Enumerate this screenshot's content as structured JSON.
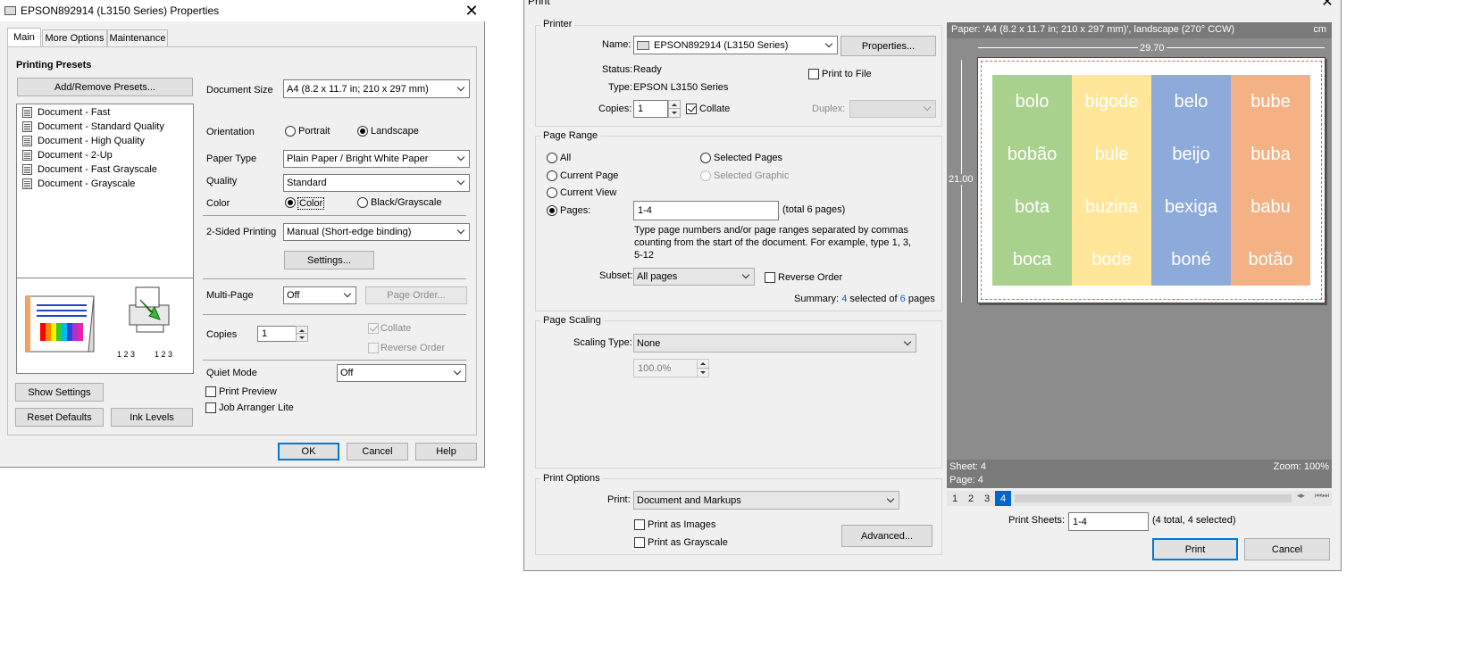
{
  "props": {
    "title": "EPSON892914 (L3150 Series) Properties",
    "tabs": [
      "Main",
      "More Options",
      "Maintenance"
    ],
    "presets_heading": "Printing Presets",
    "add_remove_presets": "Add/Remove Presets...",
    "presets": [
      "Document - Fast",
      "Document - Standard Quality",
      "Document - High Quality",
      "Document - 2-Up",
      "Document - Fast Grayscale",
      "Document - Grayscale"
    ],
    "show_settings": "Show Settings",
    "reset_defaults": "Reset Defaults",
    "ink_levels": "Ink Levels",
    "document_size_label": "Document Size",
    "document_size_value": "A4 (8.2 x 11.7 in; 210 x 297 mm)",
    "orientation_label": "Orientation",
    "portrait": "Portrait",
    "landscape": "Landscape",
    "paper_type_label": "Paper Type",
    "paper_type_value": "Plain Paper / Bright White Paper",
    "quality_label": "Quality",
    "quality_value": "Standard",
    "color_label": "Color",
    "color_option": "Color",
    "black_grayscale": "Black/Grayscale",
    "two_sided_label": "2-Sided Printing",
    "two_sided_value": "Manual (Short-edge binding)",
    "settings_button": "Settings...",
    "multi_page_label": "Multi-Page",
    "multi_page_value": "Off",
    "page_order_button": "Page Order...",
    "copies_label": "Copies",
    "copies_value": "1",
    "collate": "Collate",
    "reverse_order": "Reverse Order",
    "quiet_mode_label": "Quiet Mode",
    "quiet_mode_value": "Off",
    "print_preview": "Print Preview",
    "job_arranger": "Job Arranger Lite",
    "ok": "OK",
    "cancel": "Cancel",
    "help": "Help"
  },
  "print": {
    "title": "Print",
    "printer_group": "Printer",
    "name_label": "Name:",
    "name_value": "EPSON892914 (L3150 Series)",
    "properties_button": "Properties...",
    "status_label": "Status:",
    "status_value": "Ready",
    "type_label": "Type:",
    "type_value": "EPSON L3150 Series",
    "print_to_file": "Print to File",
    "copies_label": "Copies:",
    "copies_value": "1",
    "collate": "Collate",
    "duplex_label": "Duplex:",
    "page_range_group": "Page Range",
    "all": "All",
    "current_page": "Current Page",
    "current_view": "Current View",
    "pages": "Pages:",
    "selected_pages": "Selected Pages",
    "selected_graphic": "Selected Graphic",
    "pages_value": "1-4",
    "total_pages": "(total 6 pages)",
    "help_text_1": "Type page numbers and/or page ranges separated by commas",
    "help_text_2": "counting from the start of the document. For example, type 1, 3,",
    "help_text_3": "5-12",
    "subset_label": "Subset:",
    "subset_value": "All pages",
    "reverse_order": "Reverse Order",
    "summary_prefix": "Summary:",
    "summary_selected": "4",
    "summary_mid": "selected of",
    "summary_total": "6",
    "summary_suffix": "pages",
    "page_scaling_group": "Page Scaling",
    "scaling_type_label": "Scaling Type:",
    "scaling_type_value": "None",
    "scaling_percent": "100.0%",
    "print_options_group": "Print Options",
    "print_label": "Print:",
    "print_value": "Document and Markups",
    "print_as_images": "Print as Images",
    "print_as_grayscale": "Print as Grayscale",
    "advanced_button": "Advanced...",
    "preview_header": "Paper: 'A4 (8.2 x 11.7 in; 210 x 297 mm)', landscape (270° CCW)",
    "preview_unit": "cm",
    "ruler_width": "29.70",
    "ruler_height": "21.00",
    "grid_rows": [
      [
        "bolo",
        "bigode",
        "belo",
        "bube"
      ],
      [
        "bobão",
        "bule",
        "beijo",
        "buba"
      ],
      [
        "bota",
        "buzina",
        "bexiga",
        "babu"
      ],
      [
        "boca",
        "bode",
        "boné",
        "botão"
      ]
    ],
    "column_colors": [
      "#a9d18e",
      "#ffe699",
      "#8eaadb",
      "#f4b183"
    ],
    "sheet_label": "Sheet: 4",
    "page_label": "Page: 4",
    "zoom_label": "Zoom: 100%",
    "page_tabs": [
      "1",
      "2",
      "3",
      "4"
    ],
    "print_sheets_label": "Print Sheets:",
    "print_sheets_value": "1-4",
    "print_sheets_summary": "(4 total, 4 selected)",
    "print_button": "Print",
    "cancel_button": "Cancel"
  }
}
